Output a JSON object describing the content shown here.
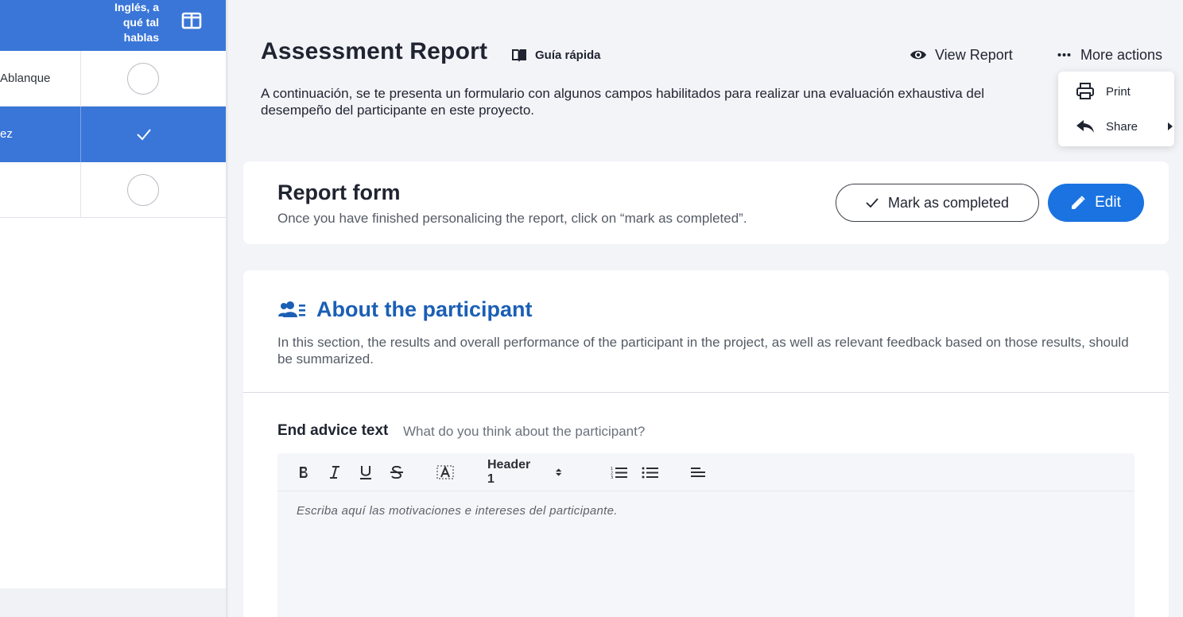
{
  "table": {
    "column_header": "Inglés, a\nqué tal\nhablas",
    "rows": [
      {
        "name": "Ablanque",
        "selected": false
      },
      {
        "name": "ez",
        "selected": true
      },
      {
        "name": "",
        "selected": false
      }
    ]
  },
  "header": {
    "title": "Assessment Report",
    "guide_label": "Guía rápida",
    "view_report_label": "View Report",
    "more_actions_label": "More actions",
    "intro": "A continuación, se te presenta un formulario con algunos campos habilitados para realizar una evaluación exhaustiva del desempeño del participante en este proyecto."
  },
  "menu": {
    "print_label": "Print",
    "share_label": "Share"
  },
  "report_form": {
    "title": "Report form",
    "subtitle": "Once you have finished personalicing the report, click on “mark as completed”.",
    "mark_completed_label": "Mark as completed",
    "edit_label": "Edit"
  },
  "section": {
    "title": "About the participant",
    "description": "In this section, the results and overall performance of the participant in the project, as well as relevant feedback based on those results, should be summarized.",
    "field_label": "End advice text",
    "field_hint": "What do you think about the participant?",
    "header_select_value": "Header 1",
    "editor_placeholder": "Escriba aquí las motivaciones e intereses del participante."
  },
  "colors": {
    "table_header": "#3a76d8",
    "primary_button": "#1a73e0",
    "section_title": "#1b5fb5"
  }
}
